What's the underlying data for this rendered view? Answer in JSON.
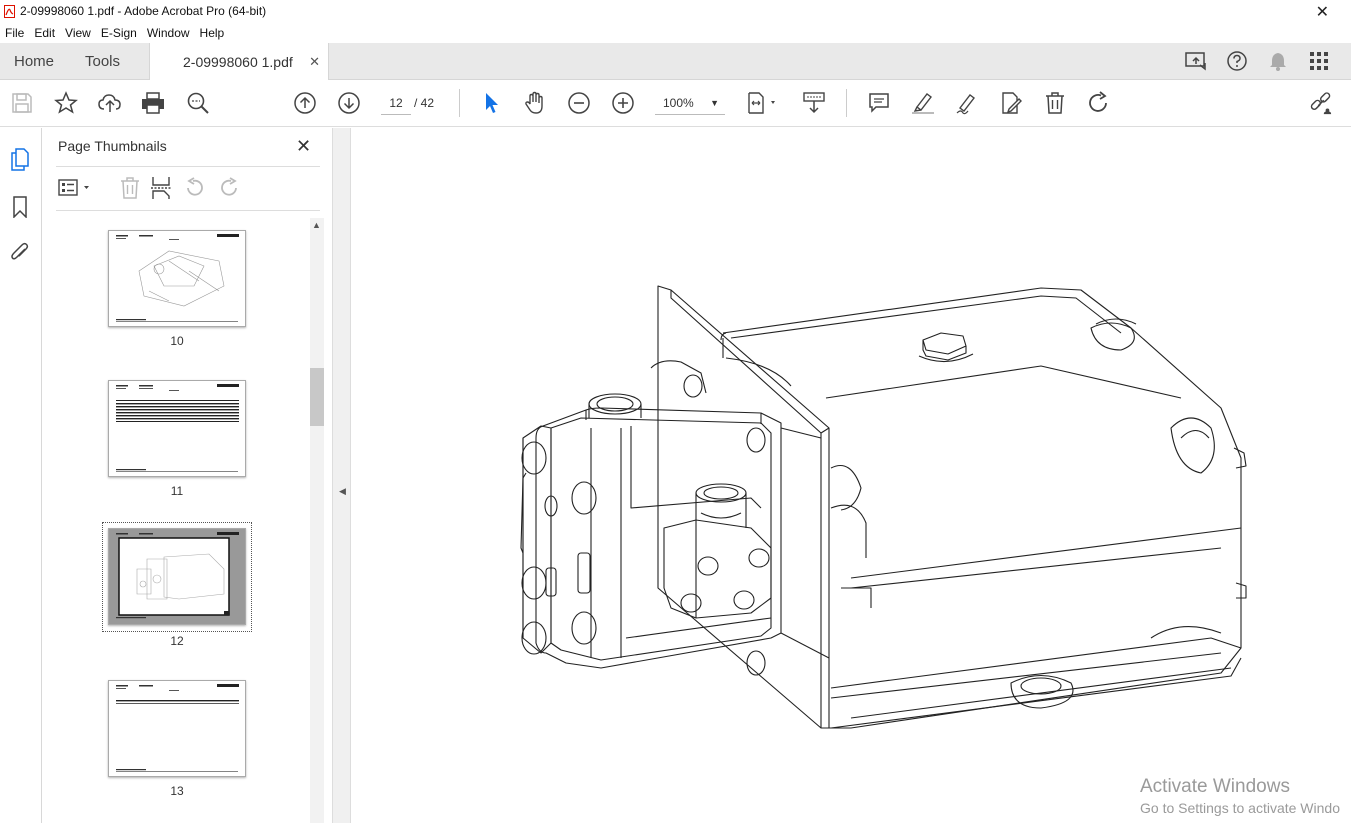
{
  "window": {
    "title": "2-09998060 1.pdf - Adobe Acrobat Pro (64-bit)"
  },
  "menu": [
    "File",
    "Edit",
    "View",
    "E-Sign",
    "Window",
    "Help"
  ],
  "tabs": {
    "home": "Home",
    "tools": "Tools",
    "document": "2-09998060 1.pdf"
  },
  "toolbar": {
    "page_current": "12",
    "page_total": "/ 42",
    "zoom": "100%"
  },
  "panel": {
    "title": "Page Thumbnails"
  },
  "thumbnails": [
    {
      "label": "10",
      "selected": false
    },
    {
      "label": "11",
      "selected": false
    },
    {
      "label": "12",
      "selected": true
    },
    {
      "label": "13",
      "selected": false
    }
  ],
  "watermark": {
    "line1": "Activate Windows",
    "line2": "Go to Settings to activate Windo"
  },
  "colors": {
    "accent_blue": "#1473e6",
    "tab_bg": "#e9e9e9"
  }
}
